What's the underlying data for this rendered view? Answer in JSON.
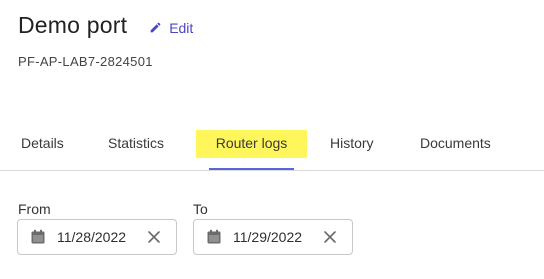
{
  "header": {
    "title": "Demo port",
    "edit_label": "Edit",
    "port_id": "PF-AP-LAB7-2824501"
  },
  "tabs": [
    {
      "label": "Details"
    },
    {
      "label": "Statistics"
    },
    {
      "label": "Router logs",
      "active": true
    },
    {
      "label": "History"
    },
    {
      "label": "Documents"
    }
  ],
  "filters": {
    "from_label": "From",
    "from_value": "11/28/2022",
    "to_label": "To",
    "to_value": "11/29/2022"
  },
  "colors": {
    "accent": "#4a46c8",
    "active_tab_highlight": "#fef65b",
    "tab_underline": "#5a66d8"
  },
  "icons": {
    "edit": "pencil-icon",
    "date": "calendar-icon",
    "clear": "close-icon"
  }
}
